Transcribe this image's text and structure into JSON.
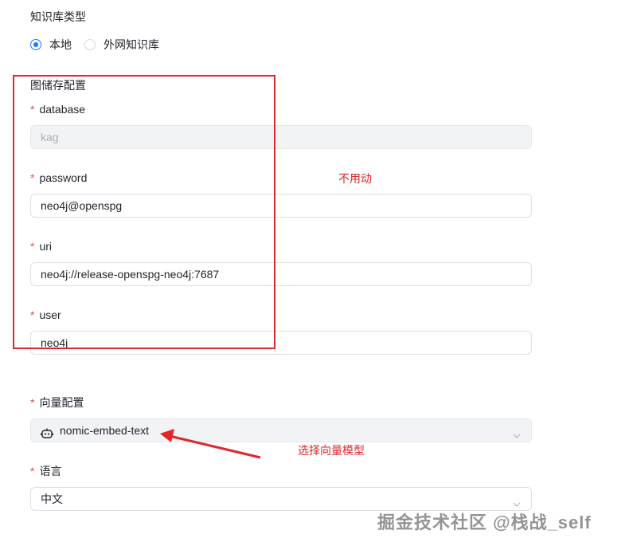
{
  "kb_type": {
    "title": "知识库类型",
    "options": [
      {
        "label": "本地",
        "selected": true
      },
      {
        "label": "外网知识库",
        "selected": false
      }
    ]
  },
  "graph_store": {
    "title": "图储存配置",
    "fields": [
      {
        "label": "database",
        "value": "",
        "placeholder": "kag",
        "disabled": true
      },
      {
        "label": "password",
        "value": "neo4j@openspg"
      },
      {
        "label": "uri",
        "value": "neo4j://release-openspg-neo4j:7687"
      },
      {
        "label": "user",
        "value": "neo4j"
      }
    ]
  },
  "vector": {
    "label": "向量配置",
    "value": "nomic-embed-text",
    "icon": "robot-icon"
  },
  "language": {
    "label": "语言",
    "value": "中文"
  },
  "required_mark": "*",
  "annotations": {
    "no_change": "不用动",
    "select_model": "选择向量模型"
  },
  "watermark": "掘金技术社区 @栈战_self",
  "colors": {
    "primary": "#1677ff",
    "annotation": "#e0262a",
    "required": "#e34d59"
  }
}
